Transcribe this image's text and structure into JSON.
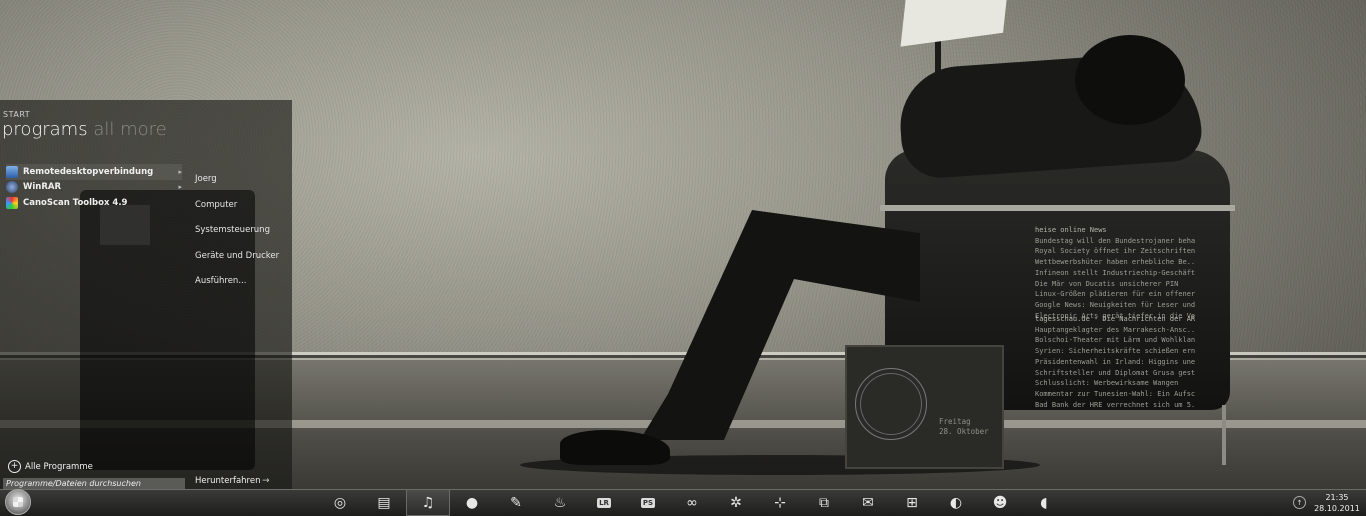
{
  "start_menu": {
    "label": "START",
    "heading": "programs",
    "heading_dim": "all more",
    "programs": [
      {
        "label": "Remotedesktopverbindung",
        "icon": "monitor-icon",
        "has_submenu": true
      },
      {
        "label": "WinRAR",
        "icon": "winrar-icon",
        "has_submenu": true
      },
      {
        "label": "CanoScan Toolbox 4.9",
        "icon": "canoscan-icon",
        "has_submenu": false
      }
    ],
    "right_links": [
      "Joerg",
      "Computer",
      "Systemsteuerung",
      "Geräte und Drucker",
      "Ausführen..."
    ],
    "all_programs": "Alle Programme",
    "search_placeholder": "Programme/Dateien durchsuchen",
    "shutdown": "Herunterfahren",
    "shutdown_arrow": "→"
  },
  "feeds": {
    "heise": {
      "title": "heise online News",
      "items": [
        "Bundestag will den Bundestrojaner behal...",
        "Royal Society öffnet ihr Zeitschriftenar...",
        "Wettbewerbshüter haben erhebliche Be...",
        "Infineon stellt Industriechip-Geschäft ne...",
        "Die Mär von Ducatis unsicherer PIN",
        "Linux-Größen plädieren für ein offenere...",
        "Google News: Neuigkeiten für Leser und...",
        "Electronic Arts gerät tiefer in die Verlu..."
      ]
    },
    "tagesschau": {
      "title": "tagesschau.de - Die Nachrichten der ARD",
      "items": [
        "Hauptangeklagter des Marrakesch-Ansc...",
        "Bolschoi-Theater mit Lärm und Wohlklang...",
        "Syrien: Sicherheitskräfte schießen erne...",
        "Präsidentenwahl in Irland: Higgins uneinh...",
        "Schriftsteller und Diplomat Grusa gestor...",
        "Schlusslicht: Werbewirksame Wangen",
        "Kommentar zur Tunesien-Wahl: Ein Aufsc...",
        "Bad Bank der HRE verrechnet sich um 5..."
      ]
    }
  },
  "date_widget": {
    "weekday": "Freitag",
    "date": "28. Oktober"
  },
  "taskbar": {
    "icons": [
      {
        "name": "chrome-icon",
        "glyph": "◎",
        "active": false
      },
      {
        "name": "explorer-icon",
        "glyph": "▤",
        "active": false
      },
      {
        "name": "music-icon",
        "glyph": "♫",
        "active": true
      },
      {
        "name": "media-player-icon",
        "glyph": "●",
        "active": false
      },
      {
        "name": "pen-icon",
        "glyph": "✎",
        "active": false
      },
      {
        "name": "fire-icon",
        "glyph": "♨",
        "active": false
      },
      {
        "name": "lightroom-icon",
        "glyph": "LR",
        "box": true,
        "active": false
      },
      {
        "name": "photoshop-icon",
        "glyph": "PS",
        "box": true,
        "active": false
      },
      {
        "name": "link-icon",
        "glyph": "∞",
        "active": false
      },
      {
        "name": "aperture-icon",
        "glyph": "✲",
        "active": false
      },
      {
        "name": "crop-icon",
        "glyph": "⊹",
        "active": false
      },
      {
        "name": "windows-icon",
        "glyph": "⧉",
        "active": false
      },
      {
        "name": "mail-icon",
        "glyph": "✉",
        "active": false
      },
      {
        "name": "network-icon",
        "glyph": "⊞",
        "active": false
      },
      {
        "name": "satellite-icon",
        "glyph": "◐",
        "active": false
      },
      {
        "name": "users-icon",
        "glyph": "☻",
        "active": false
      },
      {
        "name": "chat-icon",
        "glyph": "◖",
        "active": false
      }
    ],
    "tray_arrow": "↑",
    "clock_time": "21:35",
    "clock_date": "28.10.2011"
  }
}
